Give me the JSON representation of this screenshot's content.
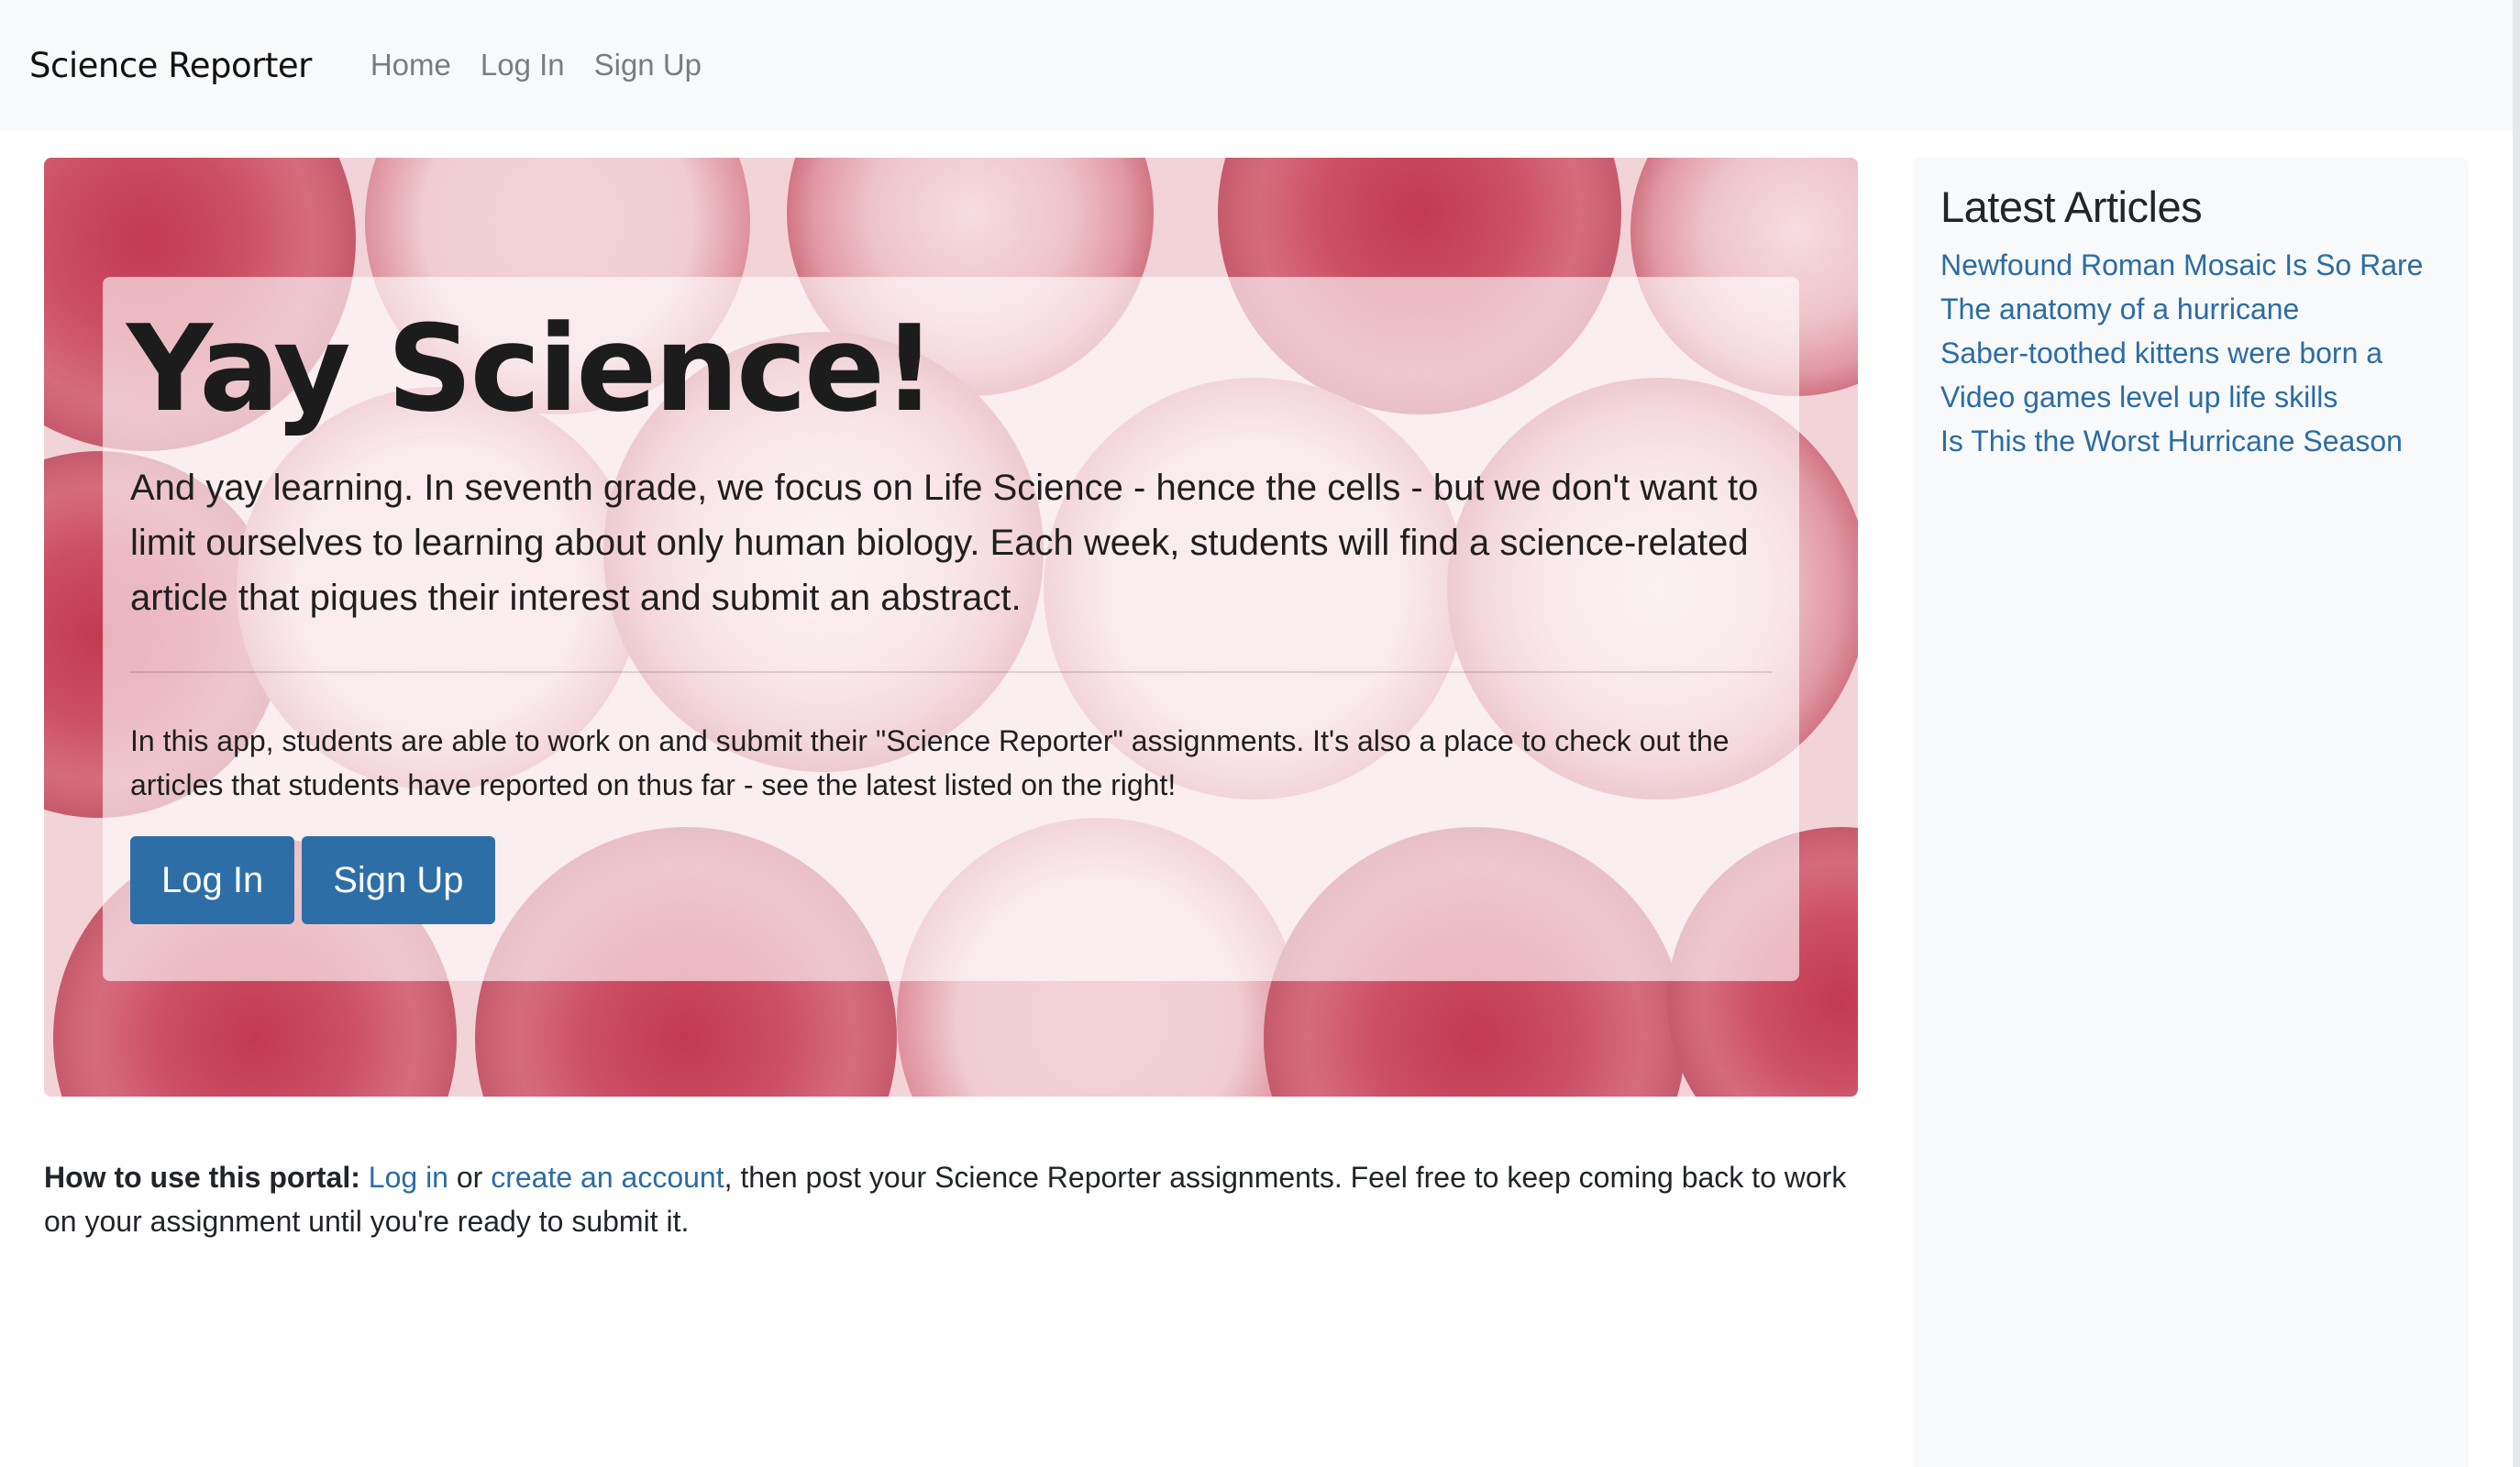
{
  "navbar": {
    "brand": "Science Reporter",
    "links": [
      "Home",
      "Log In",
      "Sign Up"
    ]
  },
  "hero": {
    "title": "Yay Science!",
    "lead": "And yay learning. In seventh grade, we focus on Life Science - hence the cells - but we don't want to limit ourselves to learning about only human biology. Each week, students will find a science-related article that piques their interest and submit an abstract.",
    "body": "In this app, students are able to work on and submit their \"Science Reporter\" assignments. It's also a place to check out the articles that students have reported on thus far - see the latest listed on the right!",
    "login_button": "Log In",
    "signup_button": "Sign Up"
  },
  "howto": {
    "label": "How to use this portal:",
    "login_link": "Log in",
    "or_text": " or ",
    "create_link": "create an account",
    "rest": ", then post your Science Reporter assignments. Feel free to keep coming back to work on your assignment until you're ready to submit it."
  },
  "sidebar": {
    "title": "Latest Articles",
    "articles": [
      "Newfound Roman Mosaic Is So Rare",
      "The anatomy of a hurricane",
      "Saber-toothed kittens were born a",
      "Video games level up life skills",
      "Is This the Worst Hurricane Season"
    ]
  },
  "colors": {
    "navbar_bg": "#f8f9fa",
    "link": "#2b6ca5",
    "button": "#2e6ea7",
    "hero_tint": "#c8405a"
  }
}
